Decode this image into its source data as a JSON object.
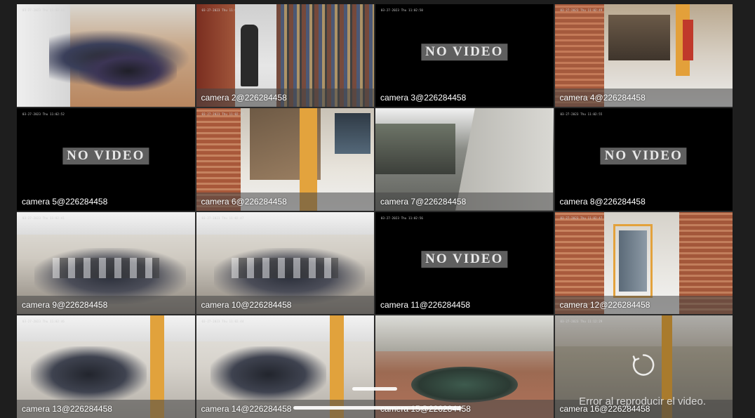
{
  "cameras": [
    {
      "caption": "",
      "osd": "03-27-2023 Thu 11:02:44",
      "status": "video",
      "scene": "parking-motorcycles",
      "selected": true
    },
    {
      "caption": "camera 2@226284458",
      "osd": "03-27-2023 Thu 11:02:48",
      "status": "video",
      "scene": "library"
    },
    {
      "caption": "camera 3@226284458",
      "osd": "03-27-2023 Thu 11:02:50",
      "status": "no-video",
      "no_video_text": "NO VIDEO"
    },
    {
      "caption": "camera 4@226284458",
      "osd": "03-27-2023 Thu 11:02:49",
      "status": "video",
      "scene": "stair-hall"
    },
    {
      "caption": "camera 5@226284458",
      "osd": "03-27-2023 Thu 11:02:52",
      "status": "no-video",
      "no_video_text": "NO VIDEO"
    },
    {
      "caption": "camera 6@226284458",
      "osd": "03-27-2023 Thu 11:02:47",
      "status": "video",
      "scene": "stairwell"
    },
    {
      "caption": "camera 7@226284458",
      "osd": "",
      "status": "video",
      "scene": "outdoor-alley"
    },
    {
      "caption": "camera 8@226284458",
      "osd": "03-27-2023 Thu 11:02:55",
      "status": "no-video",
      "no_video_text": "NO VIDEO"
    },
    {
      "caption": "camera 9@226284458",
      "osd": "03-27-2023 Thu 11:02:41",
      "status": "video",
      "scene": "computer-lab"
    },
    {
      "caption": "camera 10@226284458",
      "osd": "03-27-2023 Thu 11:02:47",
      "status": "video",
      "scene": "computer-lab"
    },
    {
      "caption": "camera 11@226284458",
      "osd": "03-27-2023 Thu 11:02:56",
      "status": "no-video",
      "no_video_text": "NO VIDEO"
    },
    {
      "caption": "camera 12@226284458",
      "osd": "03-27-2023 Thu 11:02:47",
      "status": "video",
      "scene": "elevator-hall"
    },
    {
      "caption": "camera 13@226284458",
      "osd": "03-27-2023 Thu 11:02:46",
      "status": "video",
      "scene": "classroom"
    },
    {
      "caption": "camera 14@226284458",
      "osd": "03-27-2023 Thu 11:02:44",
      "status": "video",
      "scene": "classroom"
    },
    {
      "caption": "camera 15@226284458",
      "osd": "03-27-2023 Thu 11:02:48",
      "status": "video",
      "scene": "courtyard-fountain"
    },
    {
      "caption": "camera 16@226284458",
      "osd": "03-27-2023 Thu 11:12:29",
      "status": "error",
      "scene": "cafeteria",
      "error_text": "Error al reproducir el video."
    }
  ],
  "colors": {
    "background": "#1e1e1e",
    "selection_border": "#d9211f",
    "no_video_label_bg": "#5f5f5f"
  }
}
